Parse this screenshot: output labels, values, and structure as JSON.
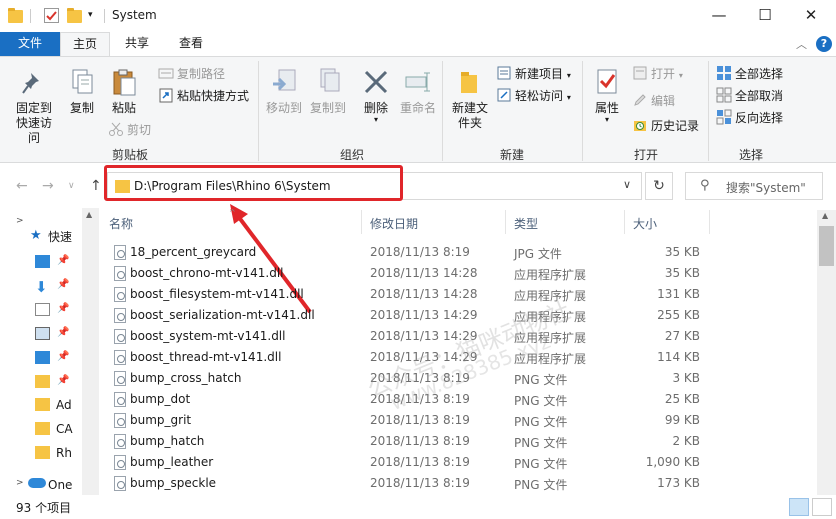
{
  "window": {
    "title": "System",
    "controls": {
      "minimize": "—",
      "maximize": "☐",
      "close": "✕"
    }
  },
  "ribbon_tabs": [
    "文件",
    "主页",
    "共享",
    "查看"
  ],
  "ribbon": {
    "clipboard": {
      "label": "剪贴板",
      "pin": "固定到快速访问",
      "copy": "复制",
      "paste": "粘贴",
      "copy_path": "复制路径",
      "paste_shortcut": "粘贴快捷方式",
      "cut": "剪切"
    },
    "organize": {
      "label": "组织",
      "move_to": "移动到",
      "copy_to": "复制到",
      "delete": "删除",
      "rename": "重命名"
    },
    "new": {
      "label": "新建",
      "new_folder": "新建文件夹",
      "new_item": "新建项目",
      "easy_access": "轻松访问"
    },
    "open": {
      "label": "打开",
      "properties": "属性",
      "open": "打开",
      "edit": "编辑",
      "history": "历史记录"
    },
    "select": {
      "label": "选择",
      "select_all": "全部选择",
      "select_none": "全部取消",
      "invert": "反向选择"
    }
  },
  "address": {
    "path": "D:\\Program Files\\Rhino 6\\System",
    "search_placeholder": "搜索\"System\""
  },
  "nav_pane": {
    "items": [
      "快速",
      "Ad",
      "CA",
      "Rh",
      "One"
    ]
  },
  "columns": {
    "name": "名称",
    "date": "修改日期",
    "type": "类型",
    "size": "大小"
  },
  "files": [
    {
      "name": "18_percent_greycard",
      "date": "2018/11/13 8:19",
      "type": "JPG 文件",
      "size": "35 KB"
    },
    {
      "name": "boost_chrono-mt-v141.dll",
      "date": "2018/11/13 14:28",
      "type": "应用程序扩展",
      "size": "35 KB"
    },
    {
      "name": "boost_filesystem-mt-v141.dll",
      "date": "2018/11/13 14:28",
      "type": "应用程序扩展",
      "size": "131 KB"
    },
    {
      "name": "boost_serialization-mt-v141.dll",
      "date": "2018/11/13 14:29",
      "type": "应用程序扩展",
      "size": "255 KB"
    },
    {
      "name": "boost_system-mt-v141.dll",
      "date": "2018/11/13 14:29",
      "type": "应用程序扩展",
      "size": "27 KB"
    },
    {
      "name": "boost_thread-mt-v141.dll",
      "date": "2018/11/13 14:29",
      "type": "应用程序扩展",
      "size": "114 KB"
    },
    {
      "name": "bump_cross_hatch",
      "date": "2018/11/13 8:19",
      "type": "PNG 文件",
      "size": "3 KB"
    },
    {
      "name": "bump_dot",
      "date": "2018/11/13 8:19",
      "type": "PNG 文件",
      "size": "25 KB"
    },
    {
      "name": "bump_grit",
      "date": "2018/11/13 8:19",
      "type": "PNG 文件",
      "size": "99 KB"
    },
    {
      "name": "bump_hatch",
      "date": "2018/11/13 8:19",
      "type": "PNG 文件",
      "size": "2 KB"
    },
    {
      "name": "bump_leather",
      "date": "2018/11/13 8:19",
      "type": "PNG 文件",
      "size": "1,090 KB"
    },
    {
      "name": "bump_speckle",
      "date": "2018/11/13 8:19",
      "type": "PNG 文件",
      "size": "173 KB"
    }
  ],
  "status": {
    "count": "93 个项目"
  },
  "watermark": {
    "line1": "公众号：猫咪动物社",
    "line2": "www.828385.xyz"
  },
  "colors": {
    "accent": "#1a6fc3",
    "highlight": "#e0262a",
    "folder": "#f6c444"
  }
}
